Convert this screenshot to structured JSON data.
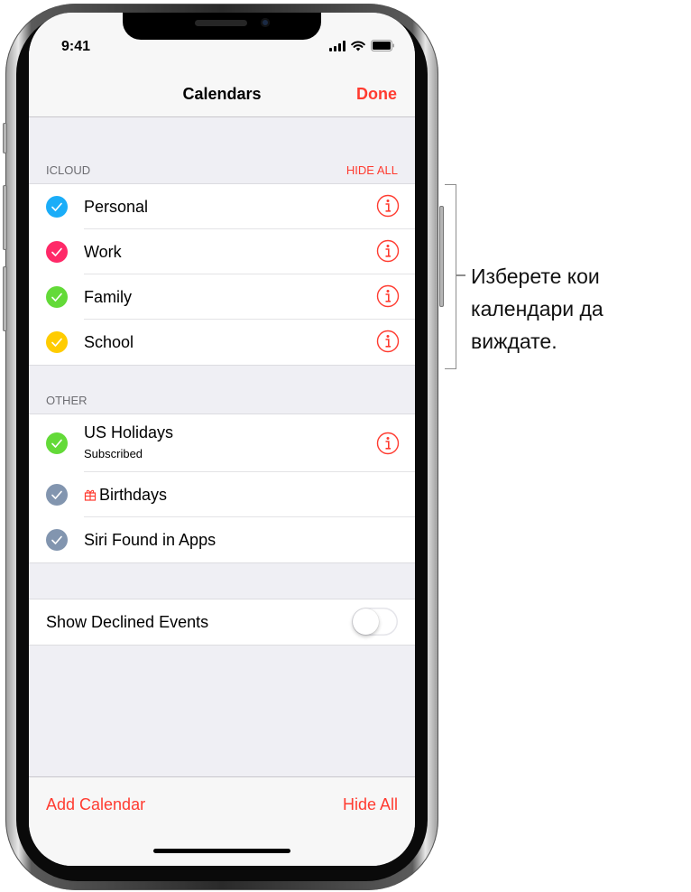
{
  "status_bar": {
    "time": "9:41",
    "icons": [
      "cellular-signal-icon",
      "wifi-icon",
      "battery-icon"
    ]
  },
  "nav": {
    "title": "Calendars",
    "done_label": "Done"
  },
  "sections": [
    {
      "header": "ICLOUD",
      "action": "HIDE ALL",
      "items": [
        {
          "label": "Personal",
          "color": "#1badf8",
          "checked": true,
          "has_info": true
        },
        {
          "label": "Work",
          "color": "#ff2968",
          "checked": true,
          "has_info": true
        },
        {
          "label": "Family",
          "color": "#63da38",
          "checked": true,
          "has_info": true
        },
        {
          "label": "School",
          "color": "#ffcc00",
          "checked": true,
          "has_info": true
        }
      ]
    },
    {
      "header": "OTHER",
      "items": [
        {
          "label": "US Holidays",
          "sublabel": "Subscribed",
          "color": "#63da38",
          "checked": true,
          "has_info": true
        },
        {
          "label": "Birthdays",
          "icon": "gift-icon",
          "color": "#8295af",
          "checked": true,
          "has_info": false
        },
        {
          "label": "Siri Found in Apps",
          "color": "#8295af",
          "checked": true,
          "has_info": false
        }
      ]
    }
  ],
  "settings": {
    "show_declined_label": "Show Declined Events",
    "show_declined_on": false
  },
  "toolbar": {
    "add_label": "Add Calendar",
    "hide_all_label": "Hide All"
  },
  "callout": {
    "text": "Изберете кои календари да виждате."
  },
  "colors": {
    "accent": "#ff3b30"
  }
}
